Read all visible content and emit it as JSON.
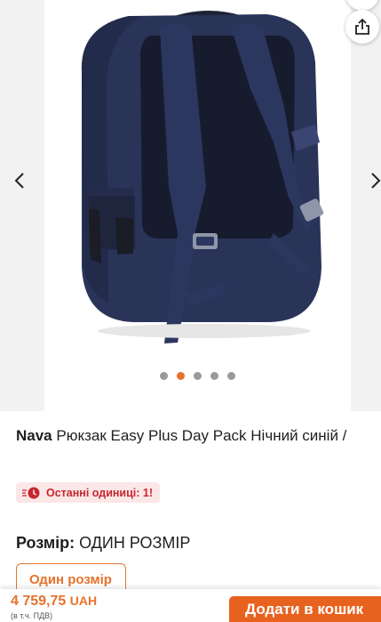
{
  "product": {
    "brand": "Nava",
    "name": "Рюкзак Easy Plus Day Pack Нічний синій /",
    "stock_badge": "Останні одиниці: 1!",
    "size_label": "Розмір:",
    "size_value": "ОДИН РОЗМІР",
    "size_option": "Один розмір"
  },
  "gallery": {
    "image_count": 5,
    "active_index": 1,
    "icons": [
      "share-icon",
      "chevron-left-icon",
      "chevron-right-icon"
    ]
  },
  "purchase": {
    "price_amount": "4 759,75",
    "currency": "UAH",
    "vat_note": "(в т.ч. ПДВ)",
    "add_to_cart": "Додати в кошик"
  },
  "colors": {
    "accent": "#e7722c",
    "cart_button": "#e8621f",
    "stock_text": "#c6262e",
    "stock_bg": "#fbe7e7",
    "backpack_navy": "#232d4f"
  }
}
